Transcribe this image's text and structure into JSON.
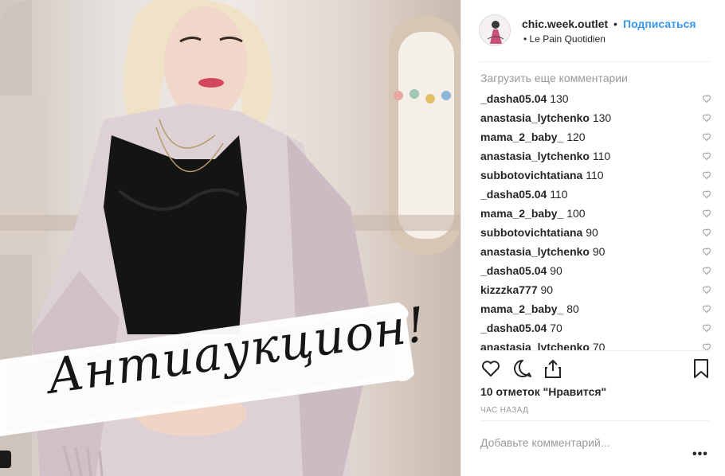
{
  "photo": {
    "banner_text": "Антиаукцион!",
    "alt": "woman in lilac coat"
  },
  "header": {
    "username": "chic.week.outlet",
    "separator": "•",
    "follow_label": "Подписаться",
    "location": "• Le Pain Quotidien"
  },
  "load_more": "Загрузить еще комментарии",
  "comments": [
    {
      "user": "_dasha05.04",
      "text": "130"
    },
    {
      "user": "anastasia_lytchenko",
      "text": "130"
    },
    {
      "user": "mama_2_baby_",
      "text": "120"
    },
    {
      "user": "anastasia_lytchenko",
      "text": "110"
    },
    {
      "user": "subbotovichtatiana",
      "text": "110"
    },
    {
      "user": "_dasha05.04",
      "text": "110"
    },
    {
      "user": "mama_2_baby_",
      "text": "100"
    },
    {
      "user": "subbotovichtatiana",
      "text": "90"
    },
    {
      "user": "anastasia_lytchenko",
      "text": "90"
    },
    {
      "user": "_dasha05.04",
      "text": "90"
    },
    {
      "user": "kizzzka777",
      "text": "90"
    },
    {
      "user": "mama_2_baby_",
      "text": "80"
    },
    {
      "user": "_dasha05.04",
      "text": "70"
    },
    {
      "user": "anastasia_lytchenko",
      "text": "70"
    }
  ],
  "likes": "10 отметок \"Нравится\"",
  "time": "ЧАС НАЗАД",
  "add_comment_placeholder": "Добавьте комментарий...",
  "more_options": "•••",
  "colors": {
    "link": "#3897f0",
    "text": "#262626",
    "muted": "#999999",
    "border": "#efefef"
  }
}
